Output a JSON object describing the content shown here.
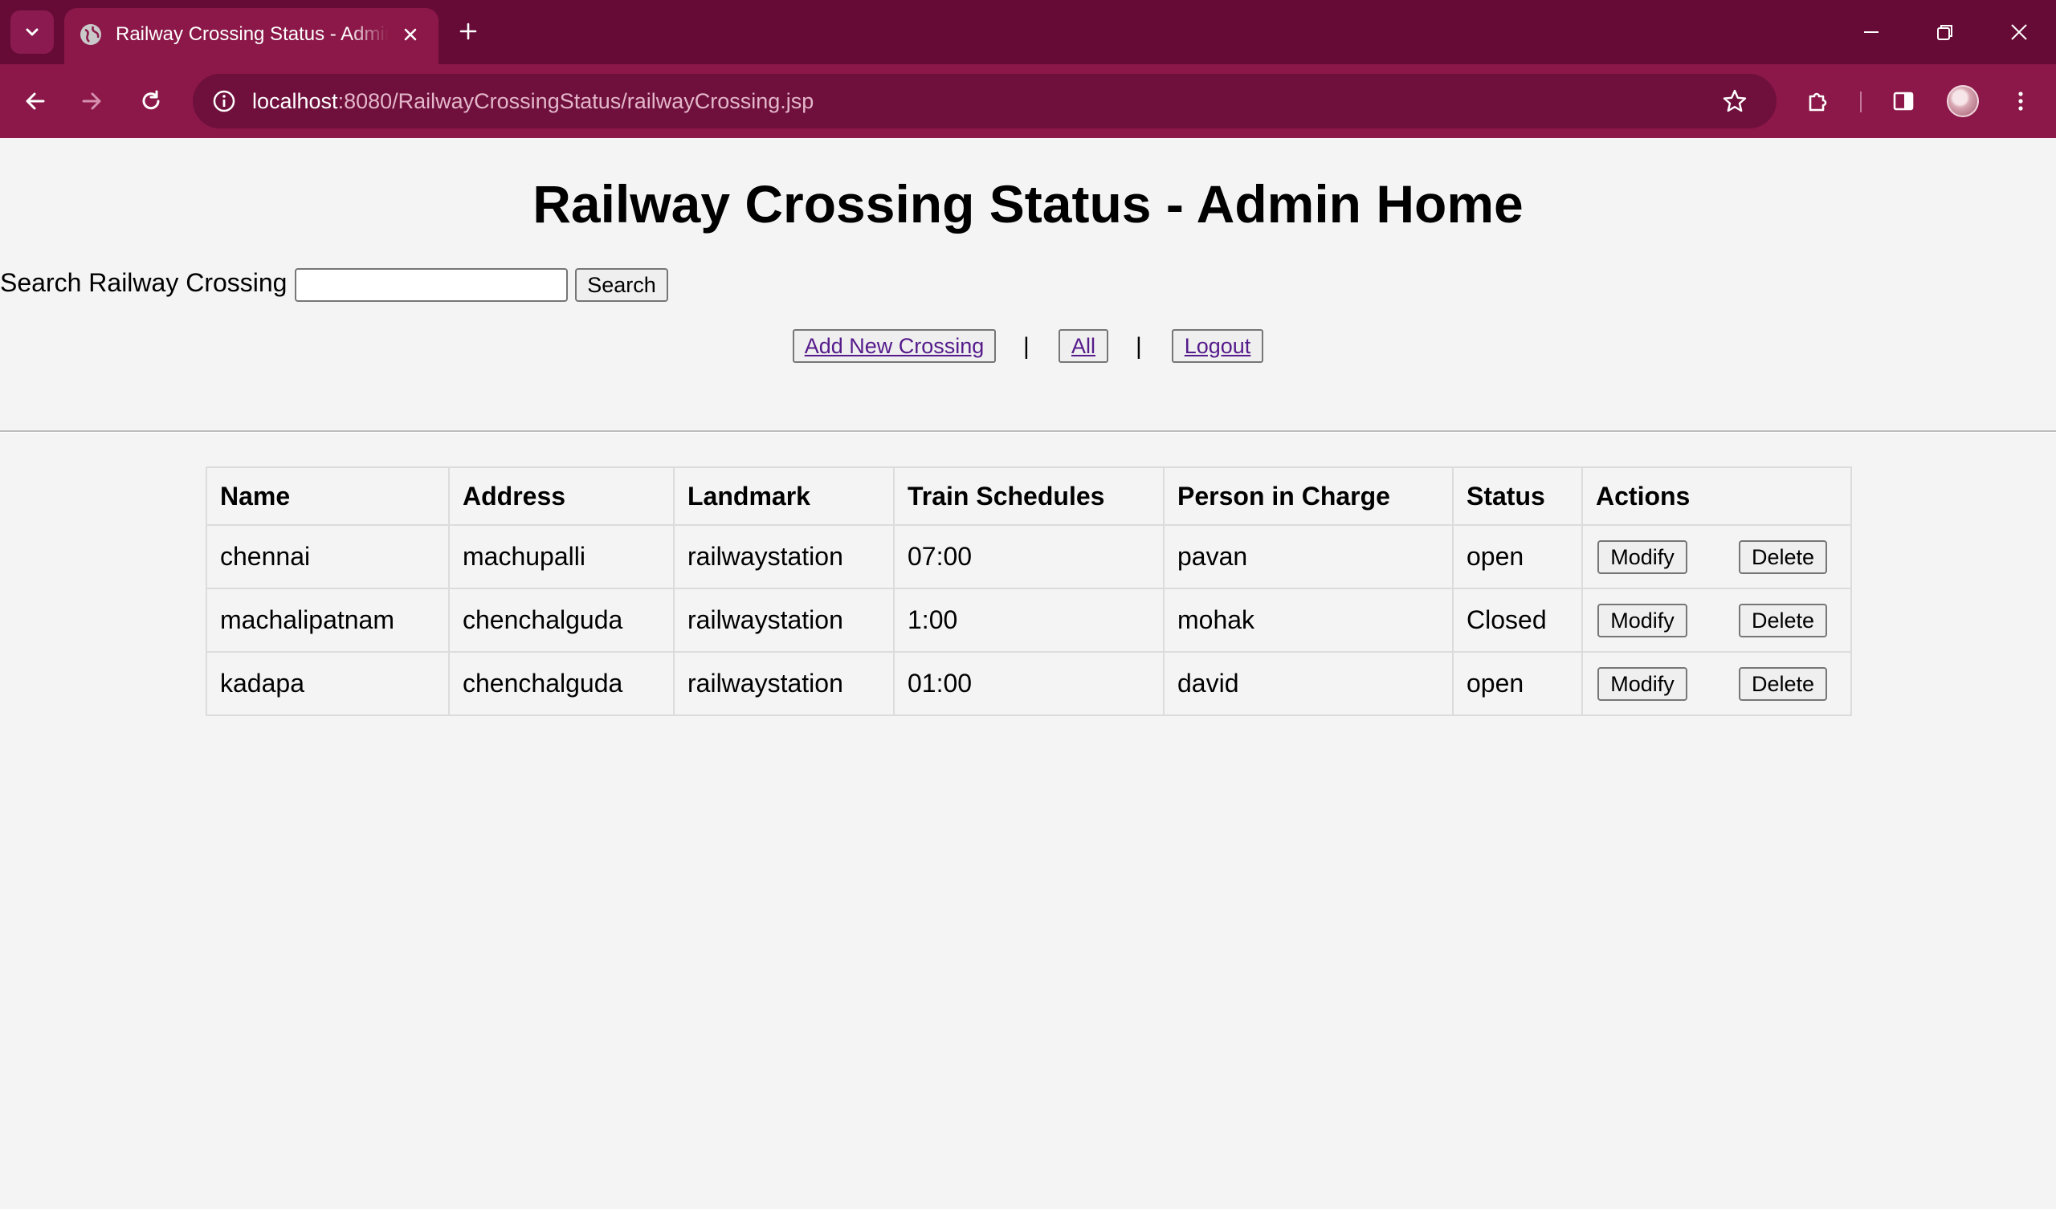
{
  "browser": {
    "tab_title": "Railway Crossing Status - Admin Home",
    "url_host": "localhost",
    "url_path": ":8080/RailwayCrossingStatus/railwayCrossing.jsp",
    "accent_color": "#660b36",
    "toolbar_color": "#8b1848"
  },
  "page": {
    "title": "Railway Crossing Status - Admin Home",
    "search_label": "Search Railway Crossing",
    "search_value": "",
    "search_button": "Search",
    "links": {
      "add_new": "Add New Crossing",
      "all": "All",
      "logout": "Logout",
      "separator": "|"
    }
  },
  "table": {
    "headers": [
      "Name",
      "Address",
      "Landmark",
      "Train Schedules",
      "Person in Charge",
      "Status",
      "Actions"
    ],
    "rows": [
      {
        "name": "chennai",
        "address": "machupalli",
        "landmark": "railwaystation",
        "schedule": "07:00",
        "person": "pavan",
        "status": "open"
      },
      {
        "name": "machalipatnam",
        "address": "chenchalguda",
        "landmark": "railwaystation",
        "schedule": "1:00",
        "person": "mohak",
        "status": "Closed"
      },
      {
        "name": "kadapa",
        "address": "chenchalguda",
        "landmark": "railwaystation",
        "schedule": "01:00",
        "person": "david",
        "status": "open"
      }
    ],
    "modify_label": "Modify",
    "delete_label": "Delete",
    "status_colors": {
      "open": "#1a8a1a",
      "closed": "#e02020"
    }
  }
}
